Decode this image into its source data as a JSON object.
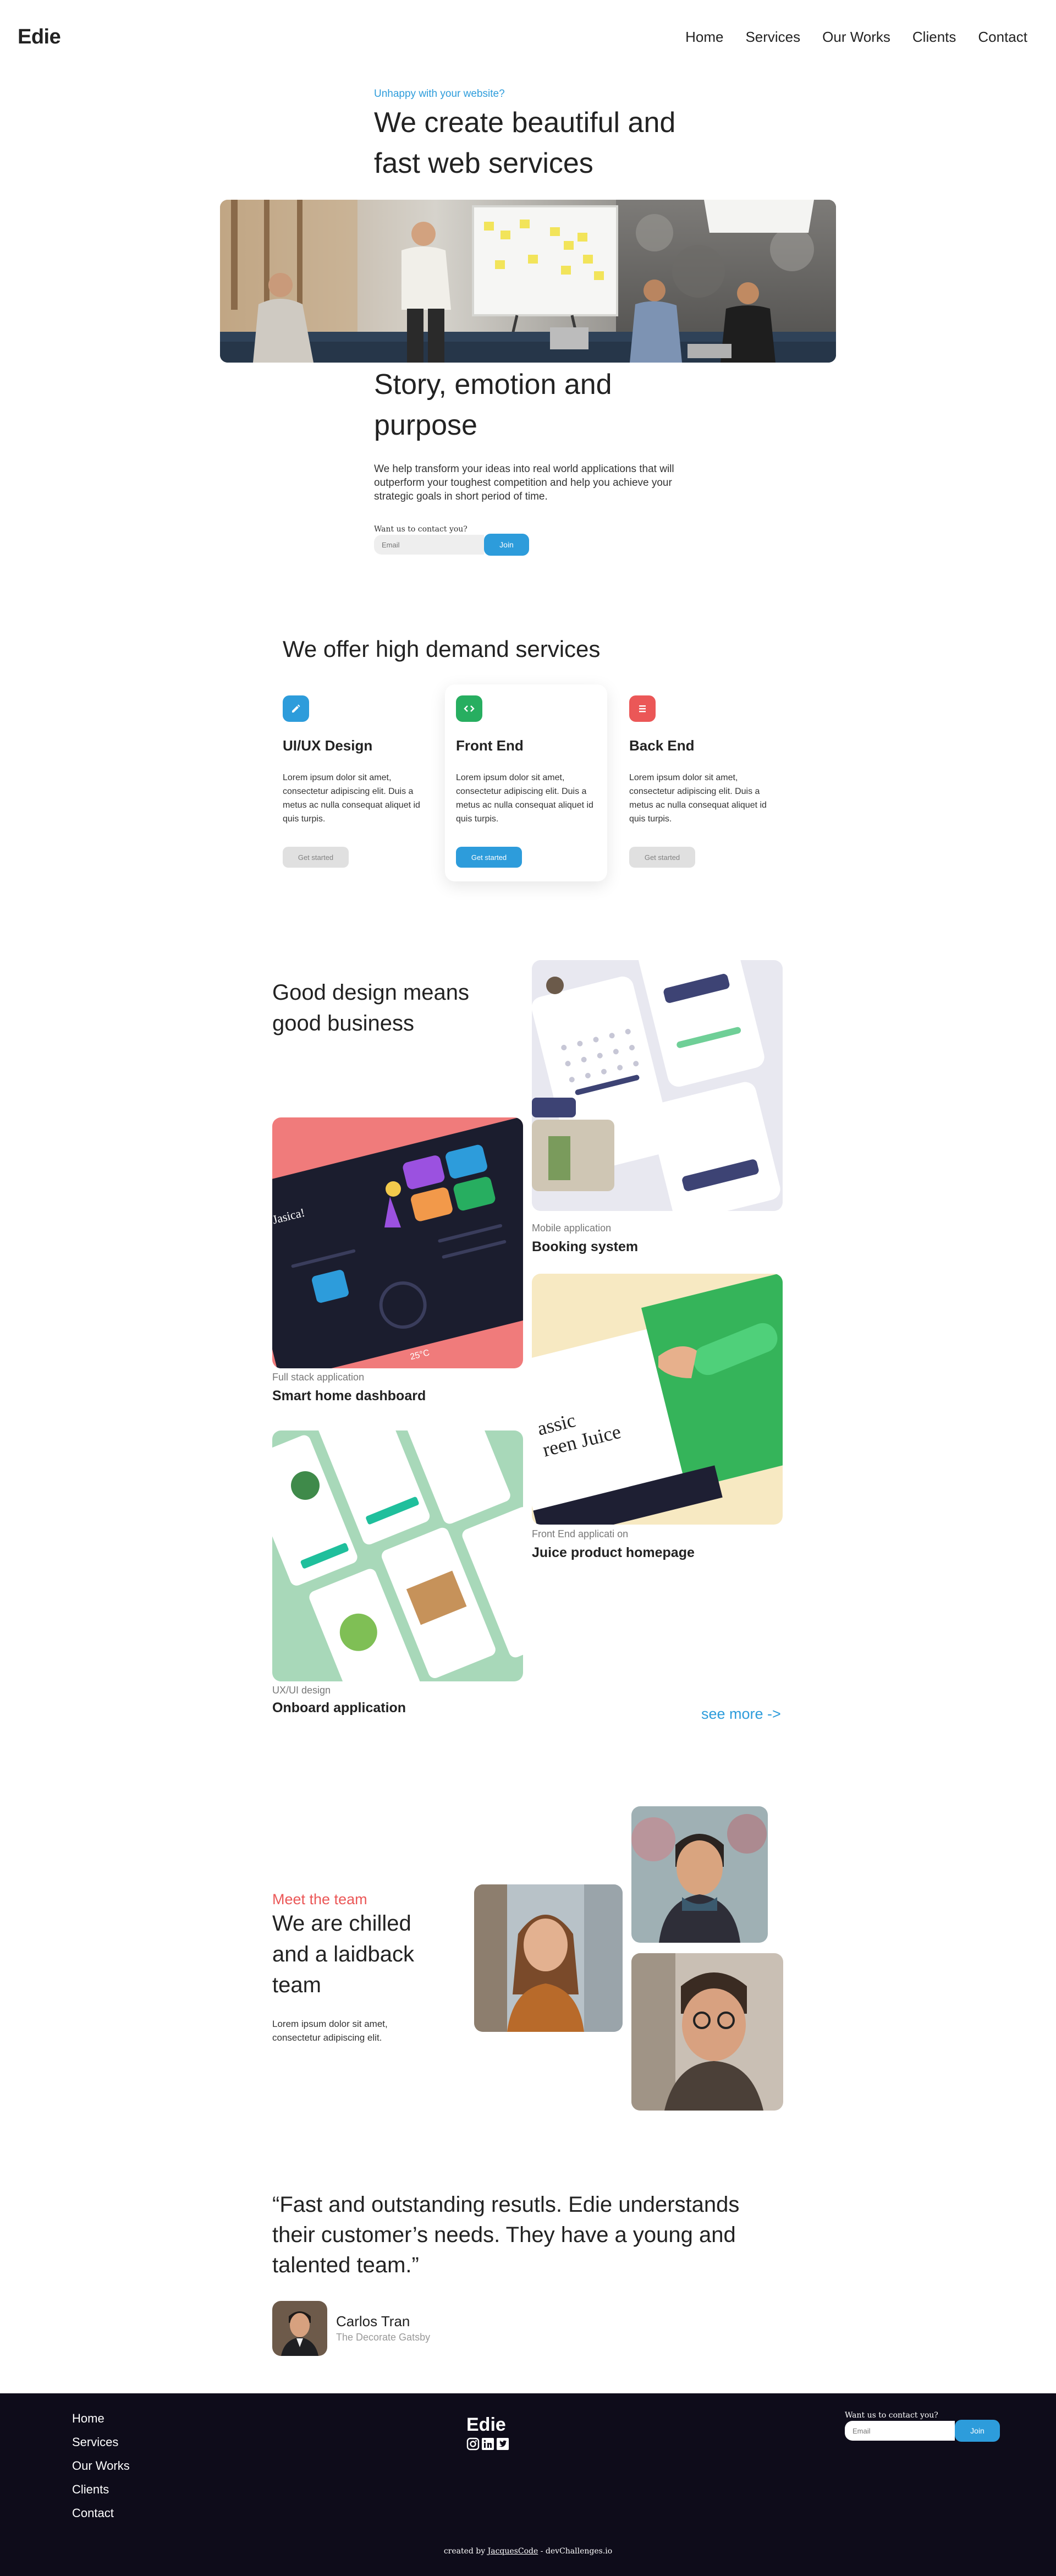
{
  "header": {
    "logo": "Edie",
    "nav": [
      "Home",
      "Services",
      "Our Works",
      "Clients",
      "Contact"
    ]
  },
  "hero": {
    "kicker": "Unhappy with your website?",
    "title": "We create beautiful and fast web services",
    "story_title": "Story, emotion and purpose",
    "story_text": "We help transform your ideas into real world applications that will outperform your toughest competition and help you achieve your strategic goals in short period of time.",
    "cta_label": "Want us to contact you?",
    "email_placeholder": "Email",
    "join_label": "Join"
  },
  "services": {
    "title": "We offer high demand services",
    "cards": [
      {
        "title": "UI/UX Design",
        "text": "Lorem ipsum dolor sit amet, consectetur adipiscing elit. Duis a metus ac nulla consequat aliquet id quis turpis.",
        "button": "Get started",
        "icon": "pencil-icon",
        "color": "#2d9cdb"
      },
      {
        "title": "Front End",
        "text": "Lorem ipsum dolor sit amet, consectetur adipiscing elit. Duis a metus ac nulla consequat aliquet id quis turpis.",
        "button": "Get started",
        "icon": "code-icon",
        "color": "#27ae60"
      },
      {
        "title": "Back End",
        "text": "Lorem ipsum dolor sit amet, consectetur adipiscing elit. Duis a metus ac nulla consequat aliquet id quis turpis.",
        "button": "Get started",
        "icon": "list-icon",
        "color": "#eb5757"
      }
    ]
  },
  "works": {
    "title": "Good design means good business",
    "items": [
      {
        "category": "Mobile application",
        "name": "Booking system"
      },
      {
        "category": "Full stack application",
        "name": "Smart home dashboard"
      },
      {
        "category": "Front End applicati on",
        "name": "Juice product homepage"
      },
      {
        "category": "UX/UI design",
        "name": "Onboard application"
      }
    ],
    "mock_text": {
      "dashboard_greeting": "Hi Jasica!",
      "thermostat": "25°C",
      "juice_title_1": "assic",
      "juice_title_2": "reen Juice"
    },
    "see_more": "see more ->"
  },
  "team": {
    "kicker": "Meet the team",
    "title": "We are chilled and a laidback team",
    "text": "Lorem ipsum dolor sit amet, consectetur adipiscing elit."
  },
  "testimonial": {
    "quote": "“Fast and outstanding resutls. Edie understands their customer’s needs. They have a young and talented team.”",
    "name": "Carlos Tran",
    "role": "The Decorate Gatsby"
  },
  "footer": {
    "links": [
      "Home",
      "Services",
      "Our Works",
      "Clients",
      "Contact"
    ],
    "logo": "Edie",
    "cta_label": "Want us to contact you?",
    "email_placeholder": "Email",
    "join_label": "Join",
    "credit_prefix": "created by",
    "credit_author": "JacquesCode",
    "credit_suffix": "- devChallenges.io"
  }
}
